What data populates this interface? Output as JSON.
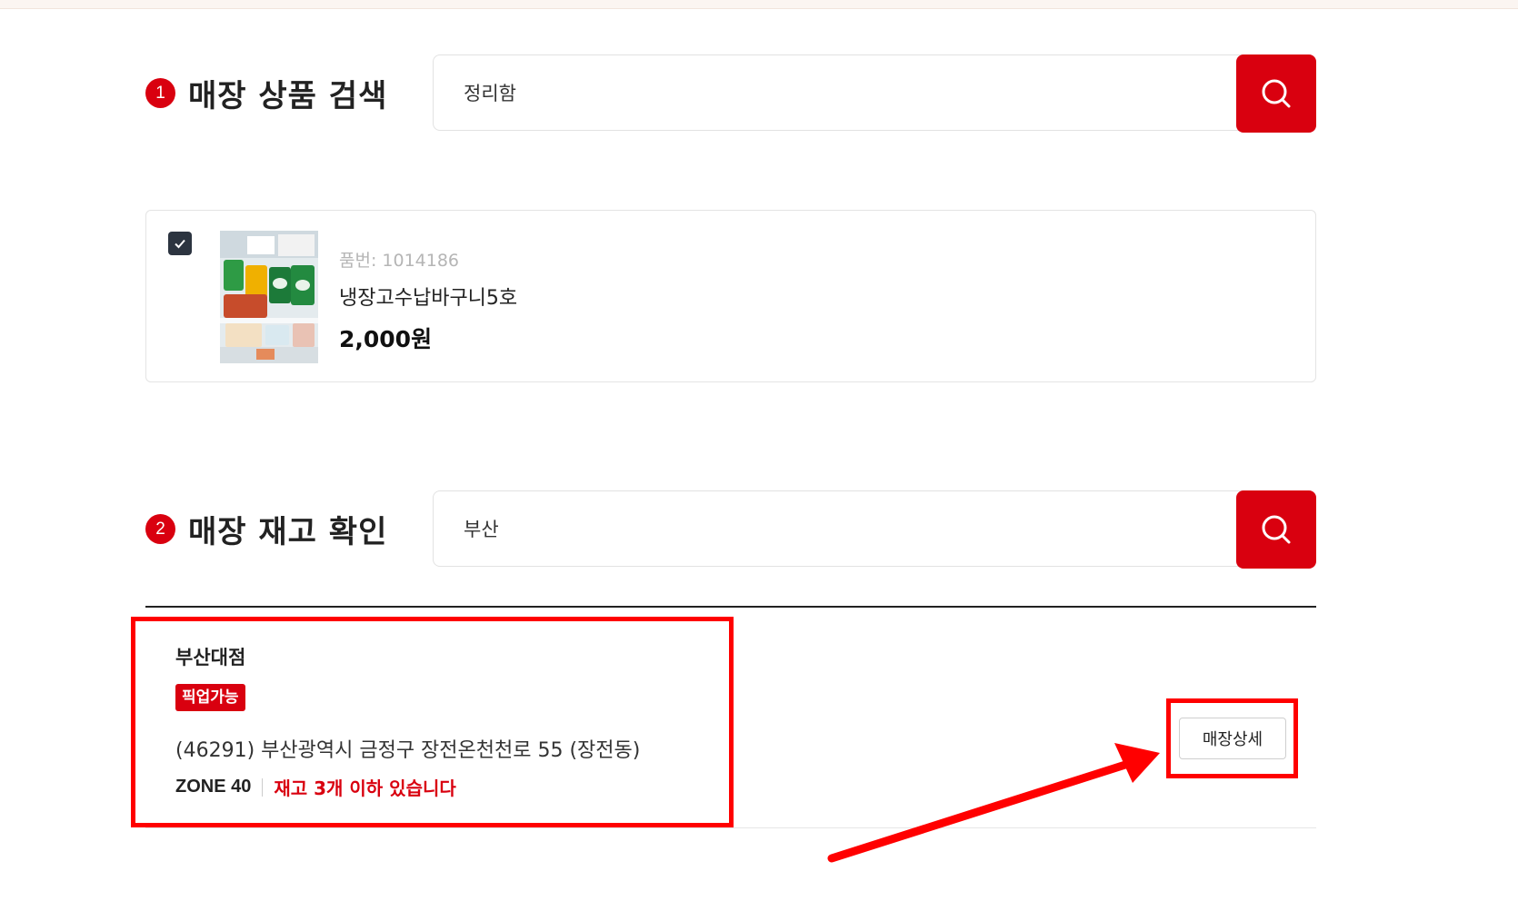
{
  "step1": {
    "number": "1",
    "title": "매장 상품 검색",
    "query": "정리함"
  },
  "product": {
    "code": "품번: 1014186",
    "name": "냉장고수납바구니5호",
    "price": "2,000원",
    "checked": true
  },
  "step2": {
    "number": "2",
    "title": "매장 재고 확인",
    "query": "부산"
  },
  "store": {
    "name": "부산대점",
    "badge": "픽업가능",
    "address": "(46291) 부산광역시 금정구 장전온천천로 55 (장전동)",
    "zone": "ZONE 40",
    "stock": "재고 3개 이하 있습니다",
    "detail_label": "매장상세"
  },
  "icons": {
    "search": "search-icon",
    "check": "check-icon"
  },
  "colors": {
    "accent": "#d9000f",
    "annotation": "#ff0000",
    "checkbox": "#2c3440"
  }
}
